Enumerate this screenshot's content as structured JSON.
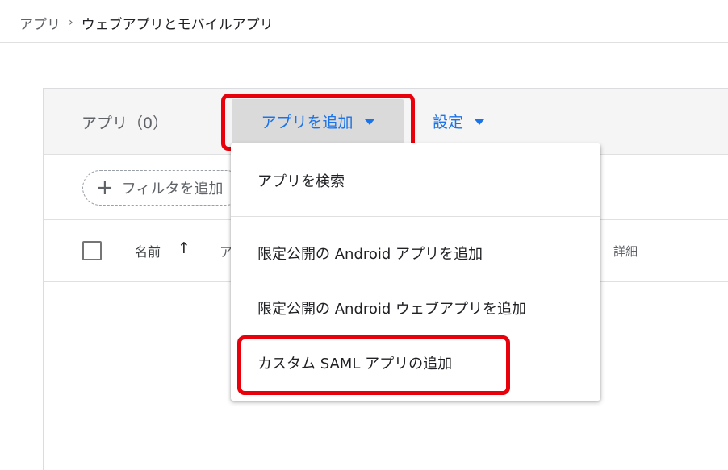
{
  "breadcrumb": {
    "parent": "アプリ",
    "separator": "›",
    "current": "ウェブアプリとモバイルアプリ"
  },
  "card": {
    "title": "アプリ（0）",
    "add_app_label": "アプリを追加",
    "settings_label": "設定"
  },
  "filter": {
    "label": "フィルタを追加"
  },
  "table": {
    "columns": {
      "name": "名前",
      "partial": "ア",
      "details": "詳細"
    }
  },
  "menu": {
    "items": [
      "アプリを検索",
      "限定公開の Android アプリを追加",
      "限定公開の Android ウェブアプリを追加",
      "カスタム SAML アプリの追加"
    ]
  },
  "colors": {
    "accent": "#1a73e8",
    "highlight": "#e8000b"
  }
}
